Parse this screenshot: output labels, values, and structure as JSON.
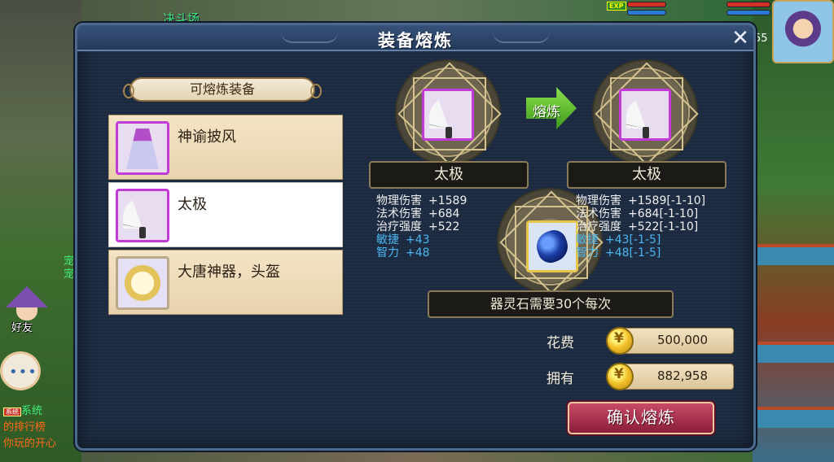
{
  "scene": {
    "arena_label": "决斗场",
    "level_text": "55",
    "friend_label": "好友",
    "chat_dots": "•••",
    "system_tag": "系统",
    "system_word": "系统",
    "system_line_1": "的排行榜",
    "system_line_2": "你玩的开心",
    "side_text_a": "宠",
    "side_text_b": "宠"
  },
  "dialog": {
    "title": "装备熔炼",
    "close_label": "✕",
    "list_header": "可熔炼装备",
    "items": [
      {
        "name": "神谕披风"
      },
      {
        "name": "太极"
      },
      {
        "name": "大唐神器，头盔"
      }
    ],
    "arrow_label": "熔炼",
    "source": {
      "name": "太极",
      "stats": [
        {
          "key": "物理伤害",
          "value": "+1589"
        },
        {
          "key": "法术伤害",
          "value": "+684"
        },
        {
          "key": "治疗强度",
          "value": "+522"
        },
        {
          "key": "敏捷",
          "value": "+43"
        },
        {
          "key": "智力",
          "value": "+48"
        }
      ]
    },
    "result": {
      "name": "太极",
      "stats": [
        {
          "key": "物理伤害",
          "value": "+1589[-1-10]"
        },
        {
          "key": "法术伤害",
          "value": "+684[-1-10]"
        },
        {
          "key": "治疗强度",
          "value": "+522[-1-10]"
        },
        {
          "key": "敏捷",
          "value": "+43[-1-5]"
        },
        {
          "key": "智力",
          "value": "+48[-1-5]"
        }
      ]
    },
    "stone_note": "器灵石需要30个每次",
    "cost_label": "花费",
    "cost_value": "500,000",
    "owned_label": "拥有",
    "owned_value": "882,958",
    "confirm_label": "确认熔炼"
  },
  "colors": {
    "panel": "#1f2e44",
    "accent_purple": "#c23ad8",
    "stat_blue": "#4ab6f0",
    "confirm": "#8a1e3a"
  }
}
